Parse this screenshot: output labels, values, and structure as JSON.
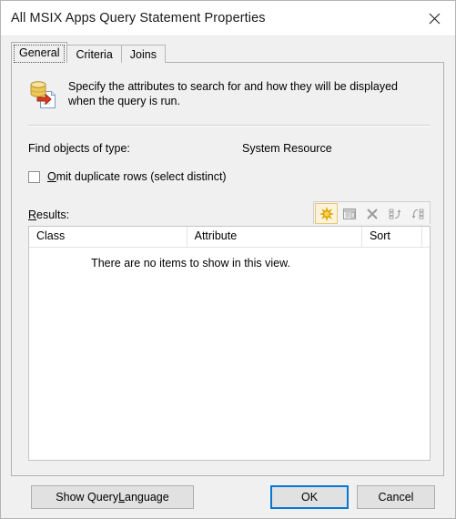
{
  "window": {
    "title": "All MSIX Apps Query Statement Properties",
    "close_icon": "close-icon"
  },
  "tabs": [
    {
      "label": "General",
      "active": true
    },
    {
      "label": "Criteria",
      "active": false
    },
    {
      "label": "Joins",
      "active": false
    }
  ],
  "general": {
    "icon": "database-export-icon",
    "description": "Specify the attributes to search for and how they will be displayed when the query is run.",
    "find_objects_label": "Find objects of type:",
    "find_objects_value": "System Resource",
    "omit_duplicates_label_prefix": "O",
    "omit_duplicates_label_rest": "mit duplicate rows (select distinct)",
    "omit_duplicates_checked": false,
    "results_label_prefix": "R",
    "results_label_rest": "esults:",
    "toolbar": [
      {
        "name": "new-icon",
        "title": "New",
        "enabled": true
      },
      {
        "name": "properties-icon",
        "title": "Properties",
        "enabled": false
      },
      {
        "name": "delete-icon",
        "title": "Delete",
        "enabled": false
      },
      {
        "name": "move-up-icon",
        "title": "Move Up",
        "enabled": false
      },
      {
        "name": "move-down-icon",
        "title": "Move Down",
        "enabled": false
      }
    ],
    "results_columns": [
      "Class",
      "Attribute",
      "Sort"
    ],
    "results_rows": [],
    "empty_message": "There are no items to show in this view."
  },
  "footer": {
    "show_query_prefix": "Show Query ",
    "show_query_accel": "L",
    "show_query_suffix": "anguage",
    "ok_label": "OK",
    "cancel_label": "Cancel"
  },
  "colors": {
    "accent": "#0078d7",
    "dialog_bg": "#f0f0f0",
    "titlebar_bg": "#ffffff",
    "list_bg": "#ffffff",
    "toolbar_active": "#f5b800"
  }
}
